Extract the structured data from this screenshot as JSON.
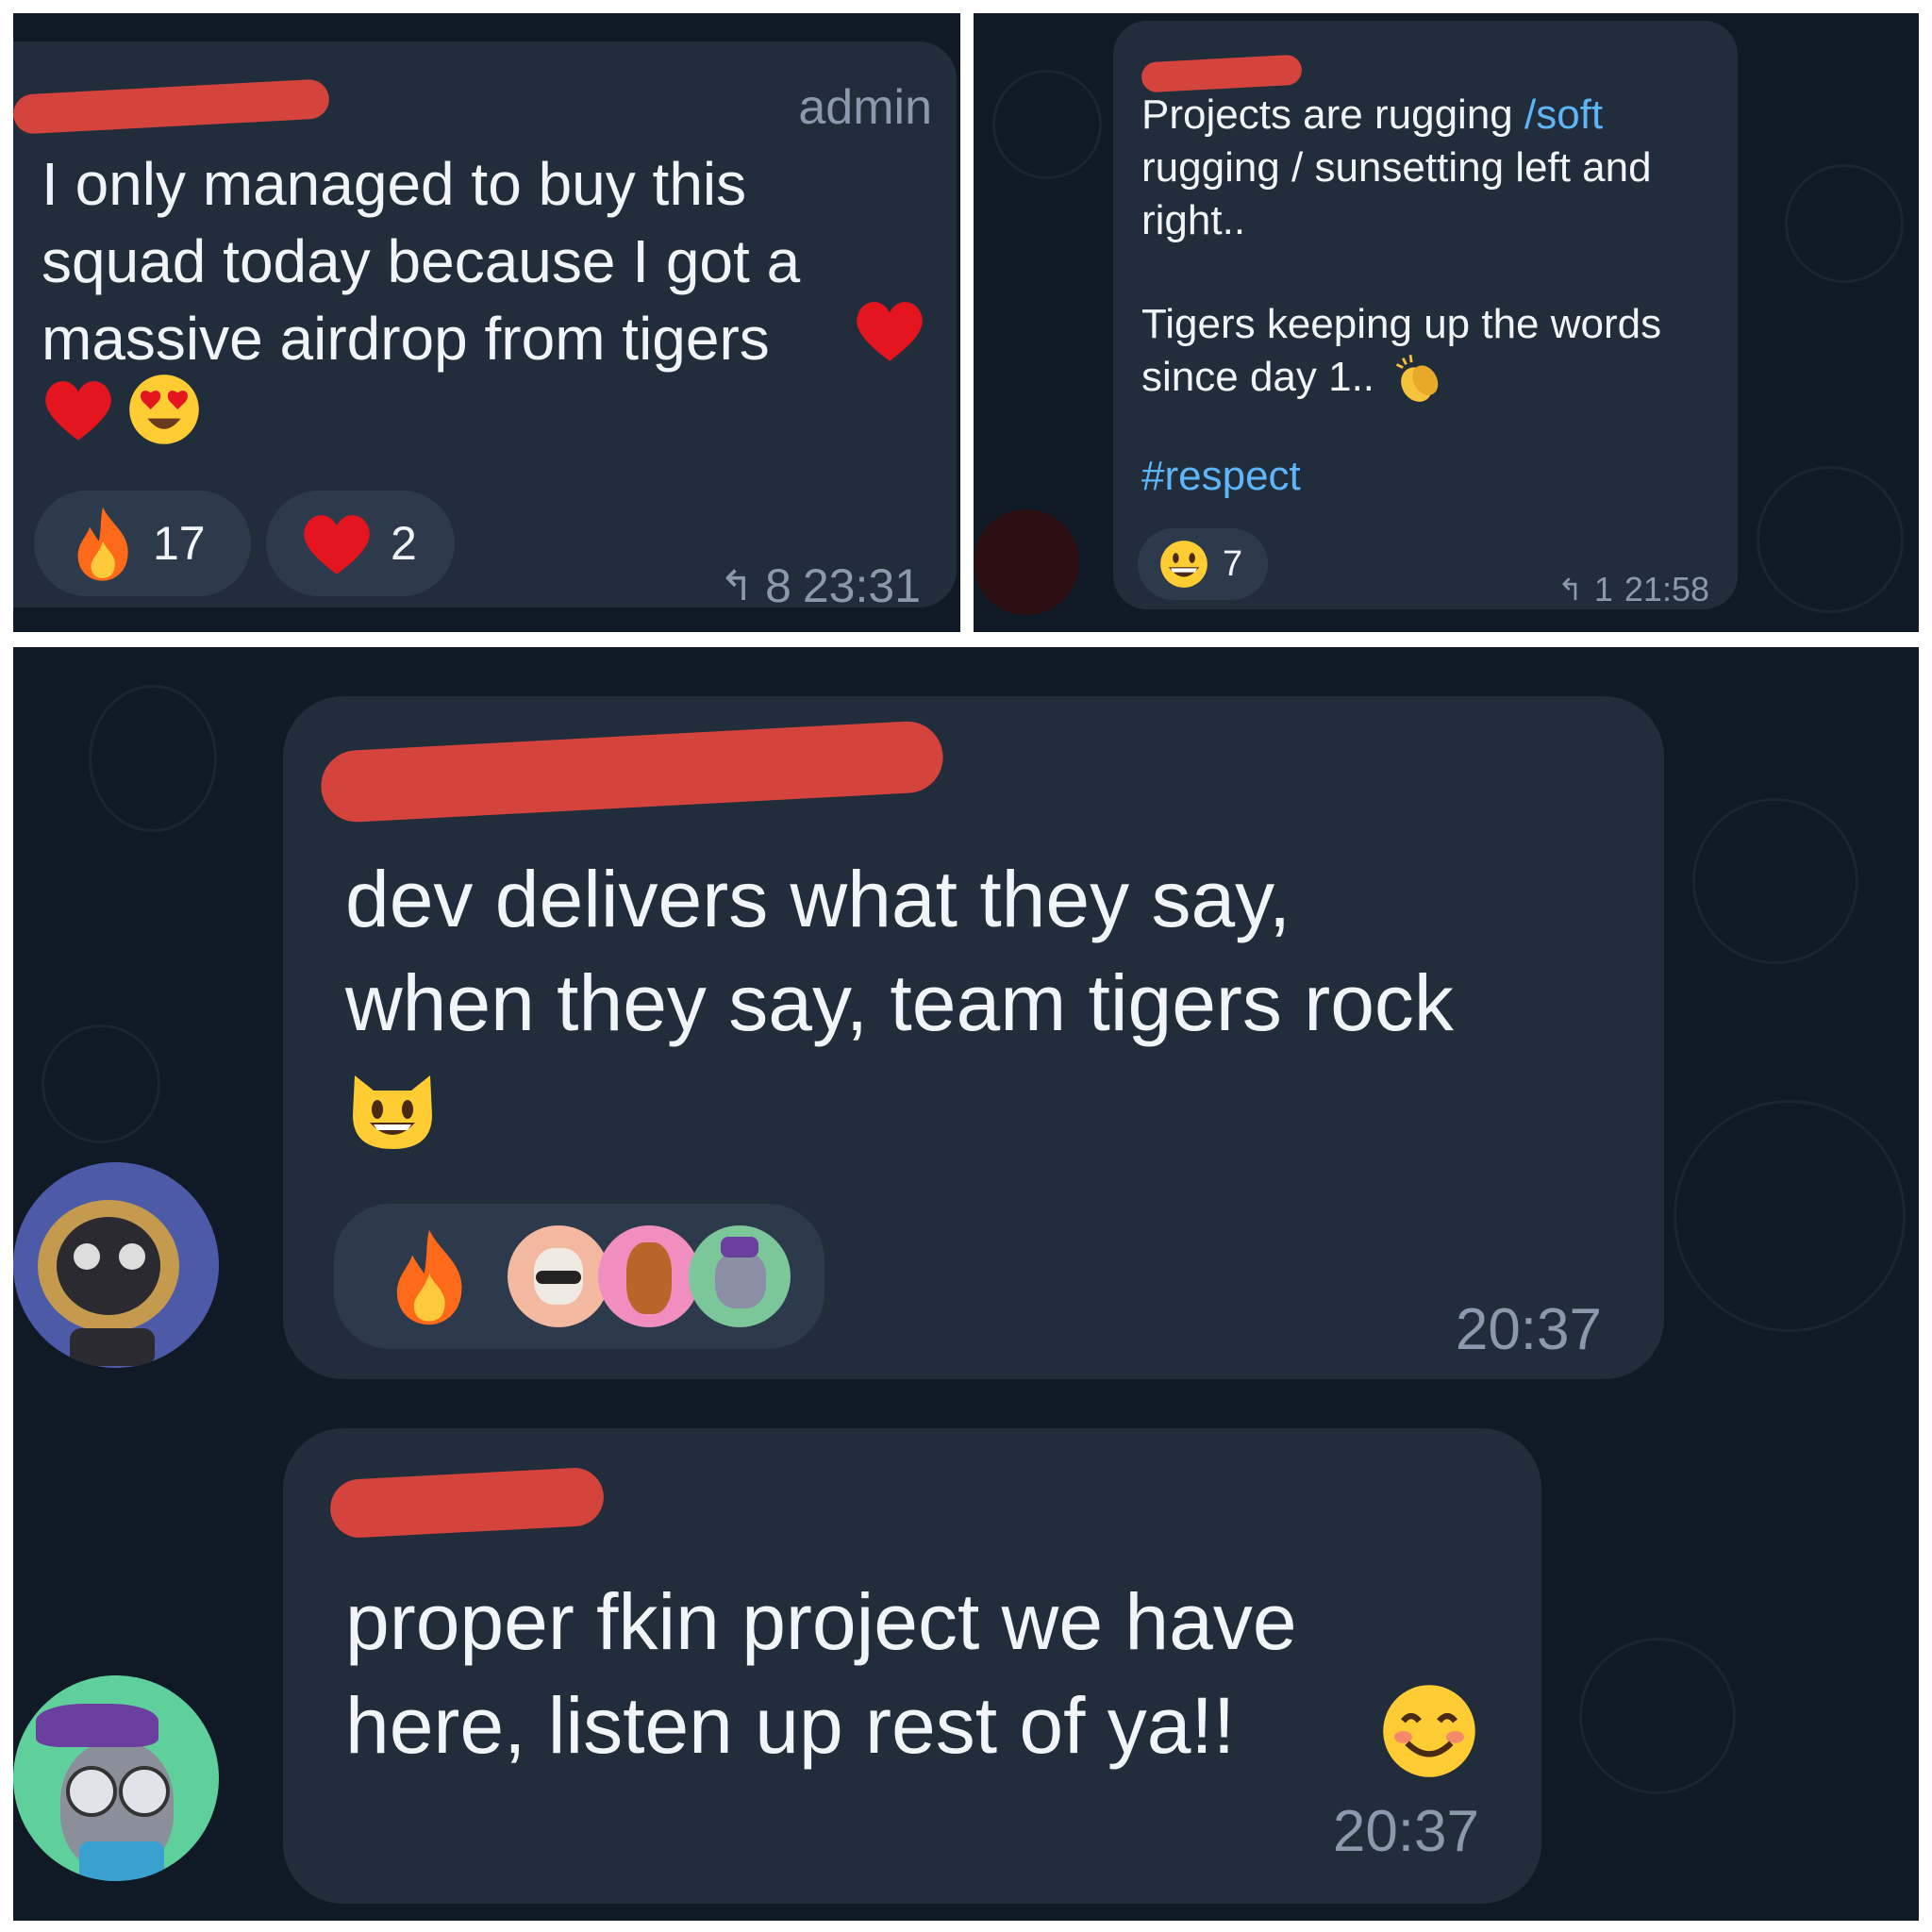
{
  "panel1": {
    "role": "admin",
    "text": "I only managed to buy this\nsquad today because I got a\nmassive airdrop from tigers",
    "reactions": [
      {
        "icon": "fire-icon",
        "count": "17"
      },
      {
        "icon": "heart-icon",
        "count": "2"
      }
    ],
    "replies": "8",
    "time": "23:31"
  },
  "panel2": {
    "text_plain": "Projects are rugging ",
    "text_link1": "/soft",
    "text_rest": "rugging / sunsetting left and\nright..",
    "text2": "Tigers keeping up the words\nsince day 1..",
    "hashtag": "#respect",
    "reaction_count": "7",
    "replies": "1",
    "time": "21:58"
  },
  "panel3": {
    "msg1": {
      "text": "dev delivers what they say,\nwhen they say, team tigers rock",
      "time": "20:37"
    },
    "msg2": {
      "text": "proper fkin project we have\nhere, listen up rest of ya!!",
      "time": "20:37"
    }
  },
  "colors": {
    "panel_bg": "#101a26",
    "bubble_bg": "#212d3b",
    "link": "#5eb5f7",
    "redaction": "#e2453c"
  }
}
